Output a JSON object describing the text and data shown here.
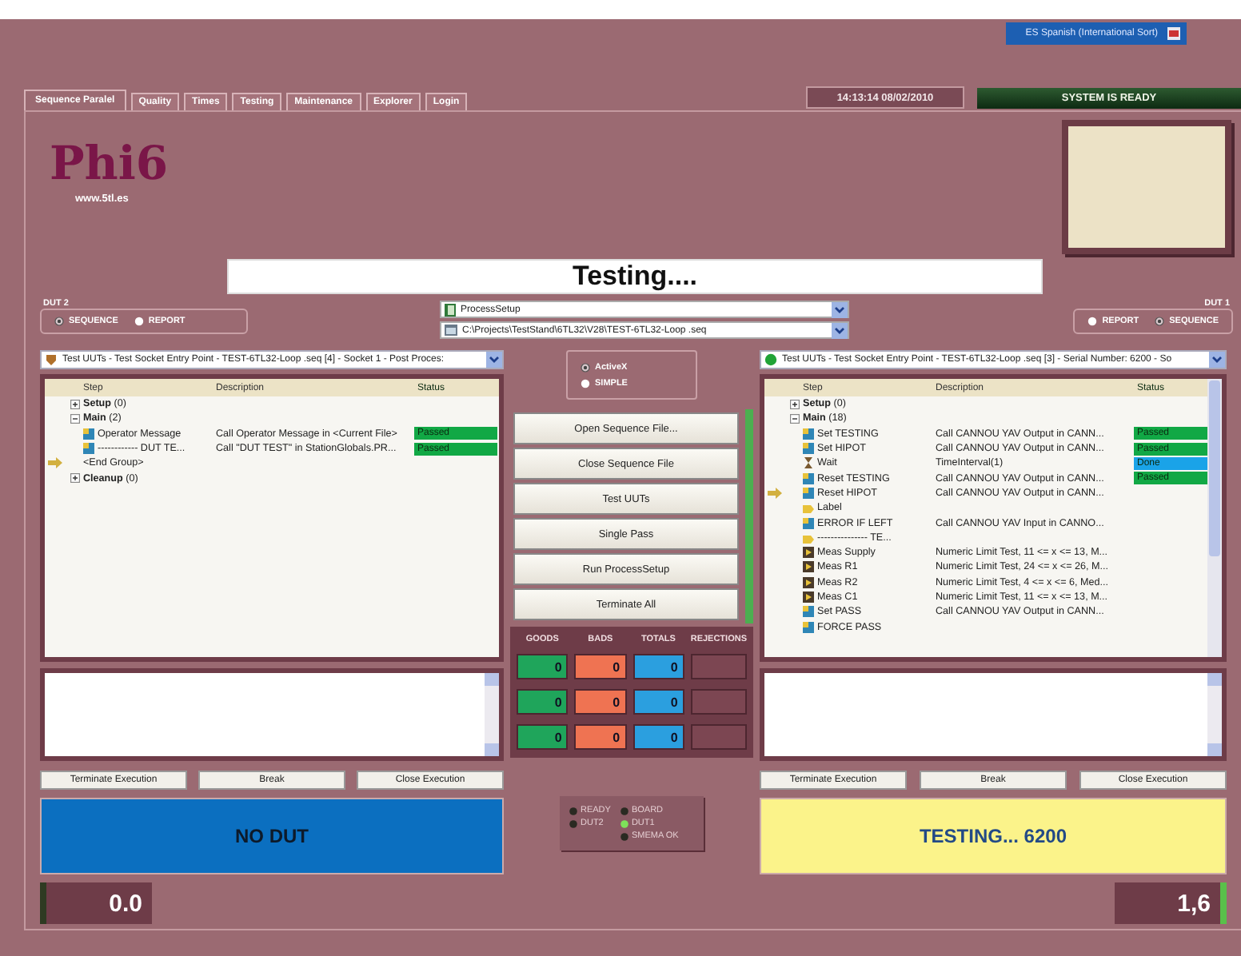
{
  "language_selector": {
    "label": "ES Spanish (International Sort)"
  },
  "tabs": [
    {
      "label": "Sequence Paralel",
      "selected": true
    },
    {
      "label": "Quality",
      "selected": false
    },
    {
      "label": "Times",
      "selected": false
    },
    {
      "label": "Testing",
      "selected": false
    },
    {
      "label": "Maintenance",
      "selected": false
    },
    {
      "label": "Explorer",
      "selected": false
    },
    {
      "label": "Login",
      "selected": false
    }
  ],
  "clock": "14:13:14  08/02/2010",
  "system_status": "SYSTEM IS READY",
  "logo": {
    "name": "Phi6",
    "url": "www.5tl.es"
  },
  "message": "Testing....",
  "sequence_selectors": [
    {
      "kind": "process",
      "value": "ProcessSetup"
    },
    {
      "kind": "file",
      "value": "C:\\Projects\\TestStand\\6TL32\\V28\\TEST-6TL32-Loop .seq"
    }
  ],
  "engine_mode": [
    {
      "label": "ActiveX",
      "selected": true
    },
    {
      "label": "SIMPLE",
      "selected": false
    }
  ],
  "actions": [
    "Open Sequence File...",
    "Close Sequence File",
    "Test UUTs",
    "Single Pass",
    "Run ProcessSetup",
    "Terminate All"
  ],
  "counters": {
    "columns": [
      {
        "label": "GOODS",
        "color": "#1fa55b"
      },
      {
        "label": "BADS",
        "color": "#ef7352"
      },
      {
        "label": "TOTALS",
        "color": "#2b9fdf"
      },
      {
        "label": "REJECTIONS",
        "color": "#7c4652"
      }
    ],
    "rows": [
      [
        "0",
        "0",
        "0"
      ],
      [
        "0",
        "0",
        "0"
      ],
      [
        "0",
        "0",
        "0"
      ]
    ]
  },
  "indicator_columns": [
    {
      "items": [
        {
          "label": "READY",
          "on": false
        },
        {
          "label": "DUT2",
          "on": false
        }
      ]
    },
    {
      "items": [
        {
          "label": "BOARD",
          "on": false
        },
        {
          "label": "DUT1",
          "on": true
        },
        {
          "label": "SMEMA OK",
          "on": false
        }
      ]
    }
  ],
  "duts": [
    {
      "title": "DUT 2",
      "view": [
        {
          "label": "SEQUENCE",
          "selected": true
        },
        {
          "label": "REPORT",
          "selected": false
        }
      ],
      "execution": {
        "running": false,
        "title": "Test UUTs - Test Socket Entry Point - TEST-6TL32-Loop .seq [4] - Socket 1 - Post Proces:"
      },
      "columns": [
        "Step",
        "Description",
        "Status"
      ],
      "steps": [
        {
          "kind": "group",
          "label": "**Setup** (0)",
          "expanded": false,
          "current": false
        },
        {
          "kind": "group",
          "label": "**Main** (2)",
          "expanded": true,
          "current": false,
          "children": [
            {
              "kind": "action",
              "name": "Operator Message",
              "description": "Call Operator Message in <Current File>",
              "status": {
                "text": "Passed",
                "color": "#11a845"
              },
              "current": false
            },
            {
              "kind": "action",
              "name": "------------ DUT TE...",
              "description": "Call \"DUT TEST\" in StationGlobals.PR...",
              "status": {
                "text": "Passed",
                "color": "#11a845"
              },
              "current": false
            },
            {
              "kind": "plain",
              "name": "<End Group>",
              "current": true
            }
          ]
        },
        {
          "kind": "group",
          "label": "**Cleanup** (0)",
          "expanded": false,
          "current": false
        }
      ],
      "buttons": [
        "Terminate Execution",
        "Break",
        "Close Execution"
      ],
      "banner": {
        "kind": "idle",
        "text": "NO DUT"
      },
      "reading": {
        "value": "0.0",
        "on": false
      }
    },
    {
      "title": "DUT 1",
      "view": [
        {
          "label": "REPORT",
          "selected": false
        },
        {
          "label": "SEQUENCE",
          "selected": true
        }
      ],
      "execution": {
        "running": true,
        "title": "Test UUTs - Test Socket Entry Point - TEST-6TL32-Loop .seq [3] - Serial Number: 6200 - So"
      },
      "columns": [
        "Step",
        "Description",
        "Status"
      ],
      "steps": [
        {
          "kind": "group",
          "label": "**Setup** (0)",
          "expanded": false,
          "current": false
        },
        {
          "kind": "group",
          "label": "**Main** (18)",
          "expanded": true,
          "current": false,
          "children": [
            {
              "kind": "action",
              "name": "Set TESTING",
              "description": "Call CANNOU YAV Output in CANN...",
              "status": {
                "text": "Passed",
                "color": "#11a845"
              },
              "current": false
            },
            {
              "kind": "action",
              "name": "Set HIPOT",
              "description": "Call CANNOU YAV Output in CANN...",
              "status": {
                "text": "Passed",
                "color": "#11a845"
              },
              "current": false
            },
            {
              "kind": "wait",
              "name": "Wait",
              "description": "TimeInterval(1)",
              "status": {
                "text": "Done",
                "color": "#1aa3e8"
              },
              "current": false
            },
            {
              "kind": "action",
              "name": "Reset TESTING",
              "description": "Call CANNOU YAV Output in CANN...",
              "status": {
                "text": "Passed",
                "color": "#11a845"
              },
              "current": false
            },
            {
              "kind": "action",
              "name": "Reset HIPOT",
              "description": "Call CANNOU YAV Output in CANN...",
              "current": true
            },
            {
              "kind": "label",
              "name": "Label",
              "current": false
            },
            {
              "kind": "action",
              "name": "ERROR IF LEFT",
              "description": "Call CANNOU YAV Input in CANNO...",
              "current": false
            },
            {
              "kind": "label",
              "name": "--------------- TE...",
              "current": false
            },
            {
              "kind": "numeric",
              "name": "Meas Supply",
              "description": "Numeric Limit Test,  11 <= x <= 13, M...",
              "current": false
            },
            {
              "kind": "numeric",
              "name": "Meas R1",
              "description": "Numeric Limit Test,  24 <= x <= 26, M...",
              "current": false
            },
            {
              "kind": "numeric",
              "name": "Meas R2",
              "description": "Numeric Limit Test,  4 <= x <= 6, Med...",
              "current": false
            },
            {
              "kind": "numeric",
              "name": "Meas C1",
              "description": "Numeric Limit Test,  11 <= x <= 13, M...",
              "current": false
            },
            {
              "kind": "action",
              "name": "Set PASS",
              "description": "Call CANNOU YAV Output in CANN...",
              "current": false
            },
            {
              "kind": "action",
              "name": "FORCE PASS",
              "current": false
            }
          ]
        }
      ],
      "buttons": [
        "Terminate Execution",
        "Break",
        "Close Execution"
      ],
      "banner": {
        "kind": "testing",
        "text": "TESTING... 6200"
      },
      "reading": {
        "value": "1,6",
        "on": true
      }
    }
  ]
}
